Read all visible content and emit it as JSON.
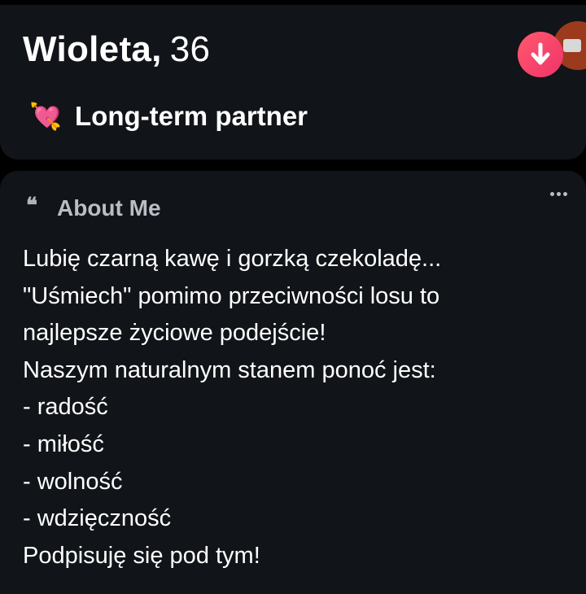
{
  "profile": {
    "name": "Wioleta,",
    "age": "36",
    "intent_emoji": "💘",
    "intent_label": "Long-term partner"
  },
  "icons": {
    "collapse": "arrow-down-icon",
    "next": "video-camera-icon",
    "quote": "quote-icon",
    "more": "more-dots-icon"
  },
  "about": {
    "quote_glyph": "❝",
    "title": "About Me",
    "lines": [
      "Lubię czarną kawę i gorzką czekoladę...",
      "\"Uśmiech\" pomimo przeciwności losu to",
      "najlepsze życiowe podejście!",
      "Naszym naturalnym stanem ponoć jest:",
      "- radość",
      "- miłość",
      "- wolność",
      "- wdzięczność",
      "Podpisuję się pod tym!"
    ]
  },
  "colors": {
    "background": "#000000",
    "card": "#111418",
    "accent_start": "#ff5a6e",
    "accent_end": "#f0326a",
    "muted_text": "#b9bec6"
  }
}
